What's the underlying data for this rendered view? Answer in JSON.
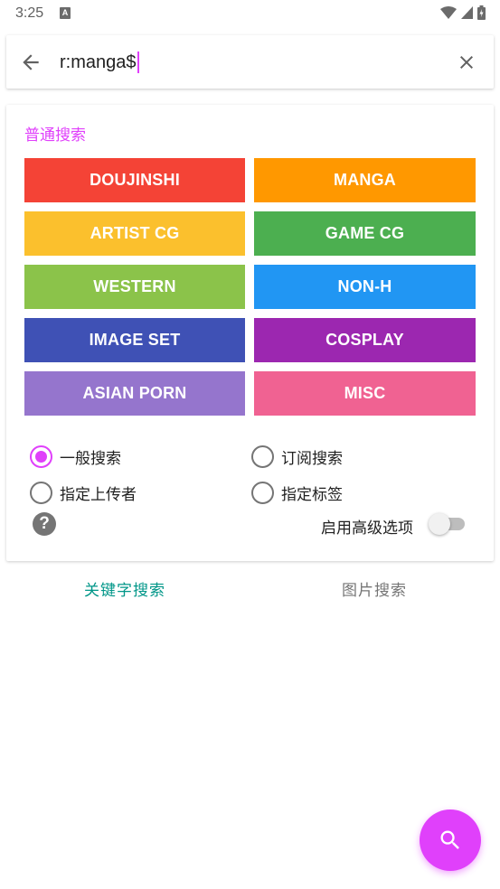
{
  "status_bar": {
    "time": "3:25",
    "notification_icon": "a-icon",
    "icons": [
      "wifi-icon",
      "signal-icon",
      "battery-charging-icon"
    ]
  },
  "search": {
    "back_icon": "arrow-left-icon",
    "value": "r:manga$",
    "clear_icon": "close-icon",
    "accent_color": "#e040fb"
  },
  "panel": {
    "title": "普通搜索",
    "categories": [
      {
        "label": "DOUJINSHI",
        "color": "#f44336"
      },
      {
        "label": "MANGA",
        "color": "#ff9800"
      },
      {
        "label": "ARTIST CG",
        "color": "#fbc02d"
      },
      {
        "label": "GAME CG",
        "color": "#4caf50"
      },
      {
        "label": "WESTERN",
        "color": "#8bc34a"
      },
      {
        "label": "NON-H",
        "color": "#2196f3"
      },
      {
        "label": "IMAGE SET",
        "color": "#3f51b5"
      },
      {
        "label": "COSPLAY",
        "color": "#9c27b0"
      },
      {
        "label": "ASIAN PORN",
        "color": "#9575cd"
      },
      {
        "label": "MISC",
        "color": "#f06292"
      }
    ],
    "search_modes": [
      {
        "label": "一般搜索",
        "checked": true
      },
      {
        "label": "订阅搜索",
        "checked": false
      },
      {
        "label": "指定上传者",
        "checked": false
      },
      {
        "label": "指定标签",
        "checked": false
      }
    ],
    "help_icon": "question-mark-icon",
    "help_glyph": "?",
    "advanced_label": "启用高级选项",
    "advanced_enabled": false
  },
  "tabs": [
    {
      "label": "关键字搜索",
      "active": true
    },
    {
      "label": "图片搜索",
      "active": false
    }
  ],
  "fab": {
    "icon": "search-icon"
  }
}
